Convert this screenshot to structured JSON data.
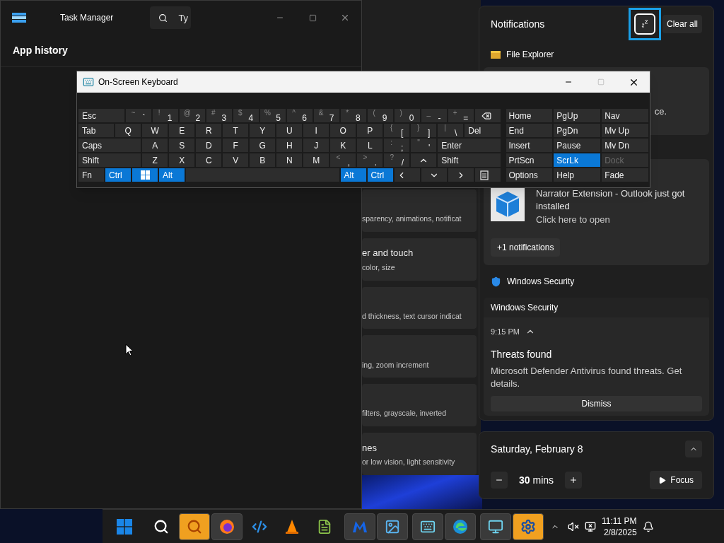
{
  "task_manager": {
    "title": "Task Manager",
    "search": {
      "placeholder": "Ty"
    },
    "page_title": "App history"
  },
  "settings": {
    "cards": [
      {
        "subtitle": "sparency, animations, notificat"
      },
      {
        "title": "er and touch",
        "subtitle": "color, size"
      },
      {
        "subtitle": "d thickness, text cursor indicat"
      },
      {
        "subtitle": "ing, zoom increment"
      },
      {
        "subtitle": "filters, grayscale, inverted"
      },
      {
        "title": "nes",
        "subtitle": "or low vision, light sensitivity"
      }
    ]
  },
  "keyboard": {
    "title": "On-Screen Keyboard",
    "rows": [
      {
        "keys": [
          {
            "kind": "wide",
            "label": "Esc",
            "on": false
          },
          {
            "kind": "char",
            "shift": "~",
            "label": "`",
            "on": false
          },
          {
            "kind": "char",
            "shift": "!",
            "label": "1",
            "on": false
          },
          {
            "kind": "char",
            "shift": "@",
            "label": "2",
            "on": false
          },
          {
            "kind": "char",
            "shift": "#",
            "label": "3",
            "on": false
          },
          {
            "kind": "char",
            "shift": "$",
            "label": "4",
            "on": false
          },
          {
            "kind": "char",
            "shift": "%",
            "label": "5",
            "on": false
          },
          {
            "kind": "char",
            "shift": "^",
            "label": "6",
            "on": false
          },
          {
            "kind": "char",
            "shift": "&",
            "label": "7",
            "on": false
          },
          {
            "kind": "char",
            "shift": "*",
            "label": "8",
            "on": false
          },
          {
            "kind": "char",
            "shift": "(",
            "label": "9",
            "on": false
          },
          {
            "kind": "char",
            "shift": ")",
            "label": "0",
            "on": false
          },
          {
            "kind": "char",
            "shift": "_",
            "label": "-",
            "on": false
          },
          {
            "kind": "char",
            "shift": "+",
            "label": "=",
            "on": false
          },
          {
            "kind": "backspace",
            "on": false
          }
        ]
      },
      {
        "keys": [
          {
            "kind": "wide",
            "label": "Tab",
            "on": false
          },
          {
            "kind": "char",
            "label": "Q",
            "on": false
          },
          {
            "kind": "char",
            "label": "W",
            "on": false
          },
          {
            "kind": "char",
            "label": "E",
            "on": false
          },
          {
            "kind": "char",
            "label": "R",
            "on": false
          },
          {
            "kind": "char",
            "label": "T",
            "on": false
          },
          {
            "kind": "char",
            "label": "Y",
            "on": false
          },
          {
            "kind": "char",
            "label": "U",
            "on": false
          },
          {
            "kind": "char",
            "label": "I",
            "on": false
          },
          {
            "kind": "char",
            "label": "O",
            "on": false
          },
          {
            "kind": "char",
            "label": "P",
            "on": false
          },
          {
            "kind": "char",
            "shift": "{",
            "label": "[",
            "on": false
          },
          {
            "kind": "char",
            "shift": "}",
            "label": "]",
            "on": false
          },
          {
            "kind": "char",
            "shift": "|",
            "label": "\\",
            "on": false
          },
          {
            "kind": "wide",
            "label": "Del",
            "on": false
          }
        ]
      },
      {
        "keys": [
          {
            "kind": "wide",
            "label": "Caps",
            "on": false
          },
          {
            "kind": "char",
            "label": "A",
            "on": false
          },
          {
            "kind": "char",
            "label": "S",
            "on": false
          },
          {
            "kind": "char",
            "label": "D",
            "on": false
          },
          {
            "kind": "char",
            "label": "F",
            "on": false
          },
          {
            "kind": "char",
            "label": "G",
            "on": false
          },
          {
            "kind": "char",
            "label": "H",
            "on": false
          },
          {
            "kind": "char",
            "label": "J",
            "on": false
          },
          {
            "kind": "char",
            "label": "K",
            "on": false
          },
          {
            "kind": "char",
            "label": "L",
            "on": false
          },
          {
            "kind": "char",
            "shift": ":",
            "label": ";",
            "on": false
          },
          {
            "kind": "char",
            "shift": "\"",
            "label": "'",
            "on": false
          },
          {
            "kind": "wide",
            "label": "Enter",
            "on": false
          }
        ]
      },
      {
        "keys": [
          {
            "kind": "wide",
            "label": "Shift",
            "on": false
          },
          {
            "kind": "char",
            "label": "Z",
            "on": false
          },
          {
            "kind": "char",
            "label": "X",
            "on": false
          },
          {
            "kind": "char",
            "label": "C",
            "on": false
          },
          {
            "kind": "char",
            "label": "V",
            "on": false
          },
          {
            "kind": "char",
            "label": "B",
            "on": false
          },
          {
            "kind": "char",
            "label": "N",
            "on": false
          },
          {
            "kind": "char",
            "label": "M",
            "on": false
          },
          {
            "kind": "char",
            "shift": "<",
            "label": ",",
            "on": false
          },
          {
            "kind": "char",
            "shift": ">",
            "label": ".",
            "on": false
          },
          {
            "kind": "char",
            "shift": "?",
            "label": "/",
            "on": false
          },
          {
            "kind": "up",
            "on": false
          },
          {
            "kind": "wide",
            "label": "Shift",
            "on": false
          }
        ]
      },
      {
        "keys": [
          {
            "kind": "char",
            "label": "Fn",
            "on": false
          },
          {
            "kind": "char",
            "label": "Ctrl",
            "on": true
          },
          {
            "kind": "win",
            "on": true
          },
          {
            "kind": "char",
            "label": "Alt",
            "on": true
          },
          {
            "kind": "space",
            "on": false
          },
          {
            "kind": "char",
            "label": "Alt",
            "on": true
          },
          {
            "kind": "char",
            "label": "Ctrl",
            "on": true
          },
          {
            "kind": "left",
            "on": false
          },
          {
            "kind": "down",
            "on": false
          },
          {
            "kind": "right",
            "on": false
          },
          {
            "kind": "menu",
            "on": false
          }
        ]
      }
    ],
    "nav_keys": [
      {
        "label": "Home",
        "on": false,
        "disabled": false
      },
      {
        "label": "PgUp",
        "on": false,
        "disabled": false
      },
      {
        "label": "Nav",
        "on": false,
        "disabled": false
      },
      {
        "label": "End",
        "on": false,
        "disabled": false
      },
      {
        "label": "PgDn",
        "on": false,
        "disabled": false
      },
      {
        "label": "Mv Up",
        "on": false,
        "disabled": false
      },
      {
        "label": "Insert",
        "on": false,
        "disabled": false
      },
      {
        "label": "Pause",
        "on": false,
        "disabled": false
      },
      {
        "label": "Mv Dn",
        "on": false,
        "disabled": false
      },
      {
        "label": "PrtScn",
        "on": false,
        "disabled": false
      },
      {
        "label": "ScrLk",
        "on": true,
        "disabled": false
      },
      {
        "label": "Dock",
        "on": false,
        "disabled": true
      },
      {
        "label": "Options",
        "on": false,
        "disabled": false
      },
      {
        "label": "Help",
        "on": false,
        "disabled": false
      },
      {
        "label": "Fade",
        "on": false,
        "disabled": false
      }
    ]
  },
  "notifications": {
    "title": "Notifications",
    "focus_button": {
      "focused": true
    },
    "clear_button": "Clear all",
    "file_explorer": {
      "app": "File Explorer",
      "card_text": "ce."
    },
    "narrator_card": {
      "title": "Narrator Extension - Outlook just got installed",
      "subtitle": "Click here to open",
      "more_button": "+1 notifications"
    },
    "security": {
      "app": "Windows Security",
      "card": {
        "header": "Windows Security",
        "time": "9:15 PM",
        "expanded": true,
        "title": "Threats found",
        "body": "Microsoft Defender Antivirus found threats. Get details.",
        "button": "Dismiss"
      }
    }
  },
  "focus_panel": {
    "date": "Saturday, February 8",
    "expanded": true,
    "duration": "30 mins",
    "focus_button": "Focus"
  },
  "taskbar": {
    "apps": [
      {
        "open": true,
        "attention": true
      },
      {
        "open": true,
        "attention": false
      },
      {
        "open": false,
        "attention": false
      },
      {
        "open": false,
        "attention": false
      },
      {
        "open": false,
        "attention": false
      },
      {
        "open": true,
        "attention": false
      },
      {
        "open": true,
        "attention": false
      },
      {
        "open": true,
        "attention": false
      },
      {
        "open": true,
        "attention": false
      },
      {
        "open": true,
        "attention": false
      },
      {
        "open": true,
        "attention": true
      }
    ],
    "clock": {
      "time": "11:11 PM",
      "date": "2/8/2025"
    }
  }
}
